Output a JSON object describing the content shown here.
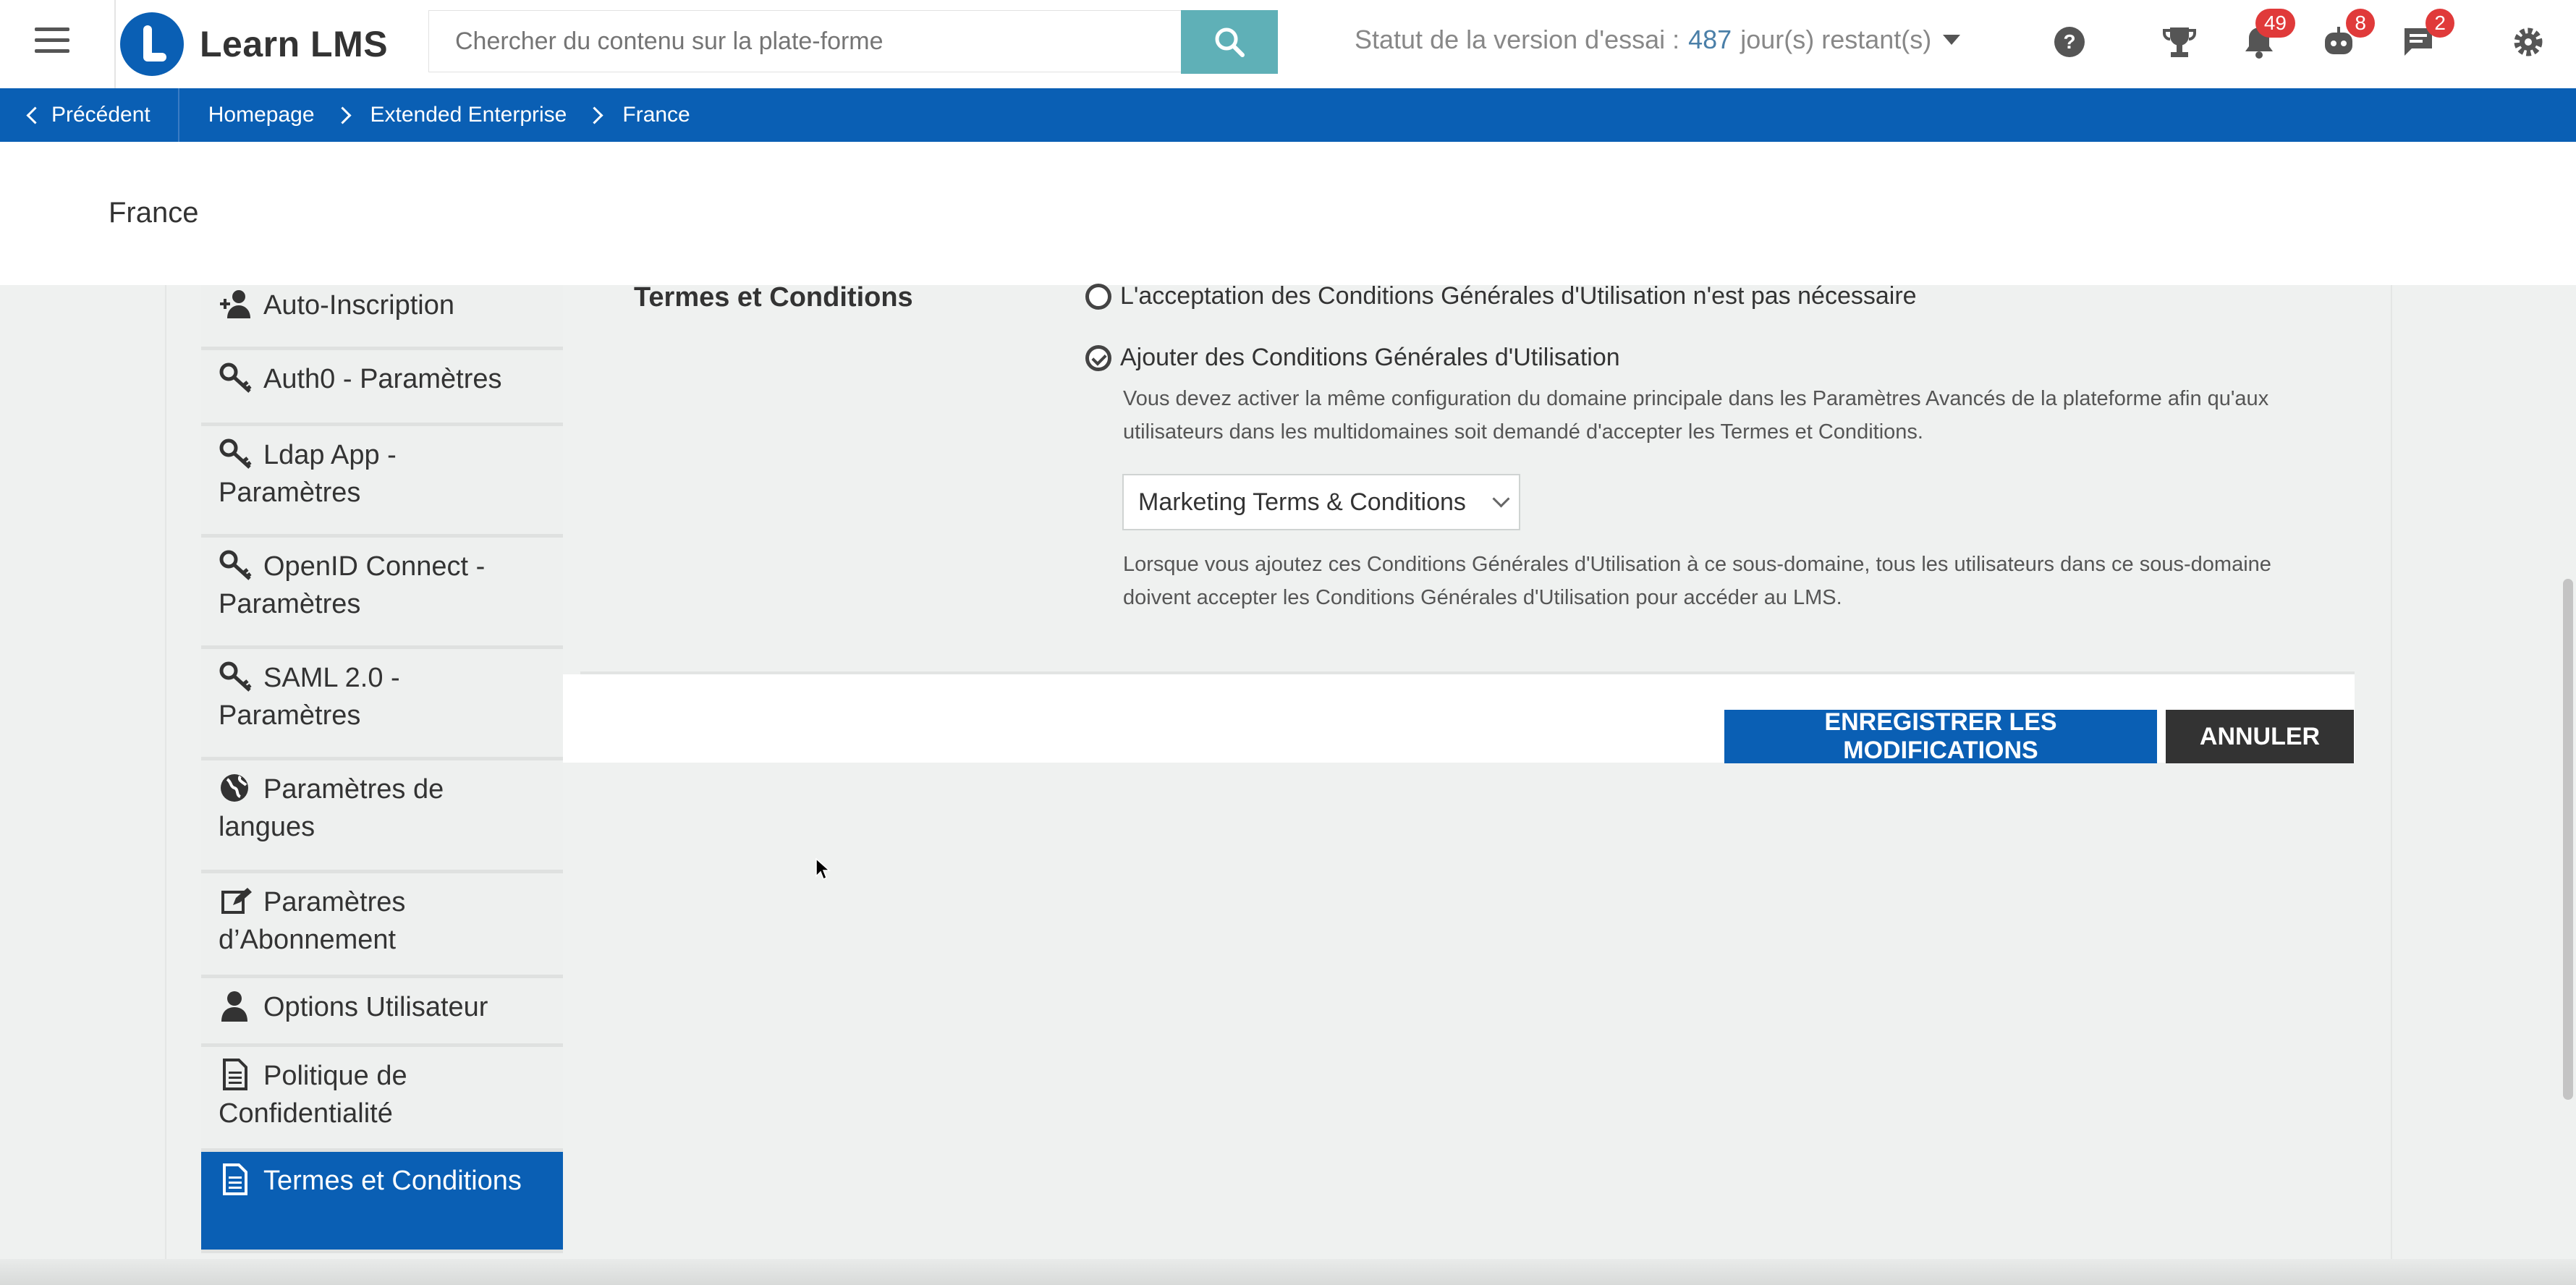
{
  "header": {
    "app_name": "Learn LMS",
    "search_placeholder": "Chercher du contenu sur la plate-forme",
    "trial_prefix": "Statut de la version d'essai :",
    "trial_days": "487",
    "trial_suffix": "jour(s) restant(s)",
    "badges": {
      "notifications": "49",
      "bot": "8",
      "messages": "2"
    }
  },
  "breadcrumb": {
    "back_label": "Précédent",
    "items": [
      "Homepage",
      "Extended Enterprise",
      "France"
    ]
  },
  "page_title": "France",
  "sidebar": {
    "items": [
      {
        "label": "Auto-Inscription",
        "icon": "user-plus-icon"
      },
      {
        "label": "Auth0 - Paramètres",
        "icon": "key-icon"
      },
      {
        "label": "Ldap App - Paramètres",
        "icon": "key-icon"
      },
      {
        "label": "OpenID Connect - Paramètres",
        "icon": "key-icon"
      },
      {
        "label": "SAML 2.0 - Paramètres",
        "icon": "key-icon"
      },
      {
        "label": "Paramètres de langues",
        "icon": "globe-icon"
      },
      {
        "label": "Paramètres d’Abonnement",
        "icon": "edit-icon"
      },
      {
        "label": "Options Utilisateur",
        "icon": "user-icon"
      },
      {
        "label": "Politique de Confidentialité",
        "icon": "document-icon"
      },
      {
        "label": "Termes et Conditions",
        "icon": "document-icon",
        "active": true
      }
    ]
  },
  "terms": {
    "section_label": "Termes et Conditions",
    "option_none": "L'acceptation des Conditions Générales d'Utilisation n'est pas nécessaire",
    "option_add": "Ajouter des Conditions Générales d'Utilisation",
    "note_main": "Vous devez activer la même configuration du domaine principale dans les Paramètres Avancés de la plateforme afin qu'aux utilisateurs dans les multidomaines soit demandé d'accepter les Termes et Conditions.",
    "selected_terms": "Marketing Terms & Conditions",
    "note_sub": "Lorsque vous ajoutez ces Conditions Générales d'Utilisation à ce sous-domaine, tous les utilisateurs dans ce sous-domaine doivent accepter les Conditions Générales d'Utilisation pour accéder au LMS."
  },
  "actions": {
    "save_label": "ENREGISTRER LES MODIFICATIONS",
    "cancel_label": "ANNULER"
  },
  "colors": {
    "brand_blue": "#0a5fb4",
    "search_button": "#5fb0b7",
    "badge_red": "#e03a3a",
    "cancel_dark": "#333333"
  }
}
